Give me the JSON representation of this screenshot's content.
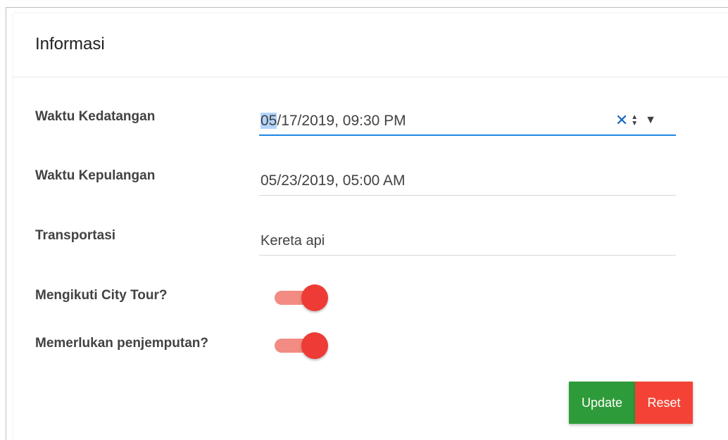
{
  "card": {
    "title": "Informasi"
  },
  "fields": {
    "arrival": {
      "label": "Waktu Kedatangan",
      "value_selected": "05",
      "value_rest": "/17/2019, 09:30 PM"
    },
    "departure": {
      "label": "Waktu Kepulangan",
      "value": "05/23/2019, 05:00 AM"
    },
    "transport": {
      "label": "Transportasi",
      "value": "Kereta api"
    },
    "city_tour": {
      "label": "Mengikuti City Tour?",
      "checked": true
    },
    "pickup": {
      "label": "Memerlukan penjemputan?",
      "checked": true
    }
  },
  "icons": {
    "clear": "✕",
    "spin_up": "▲",
    "spin_down": "▼",
    "dropdown": "▼"
  },
  "buttons": {
    "update": "Update",
    "reset": "Reset"
  },
  "colors": {
    "accent": "#1e88e5",
    "toggle_on": "#ee3b36",
    "update": "#2e9b3a",
    "reset": "#f44336"
  }
}
